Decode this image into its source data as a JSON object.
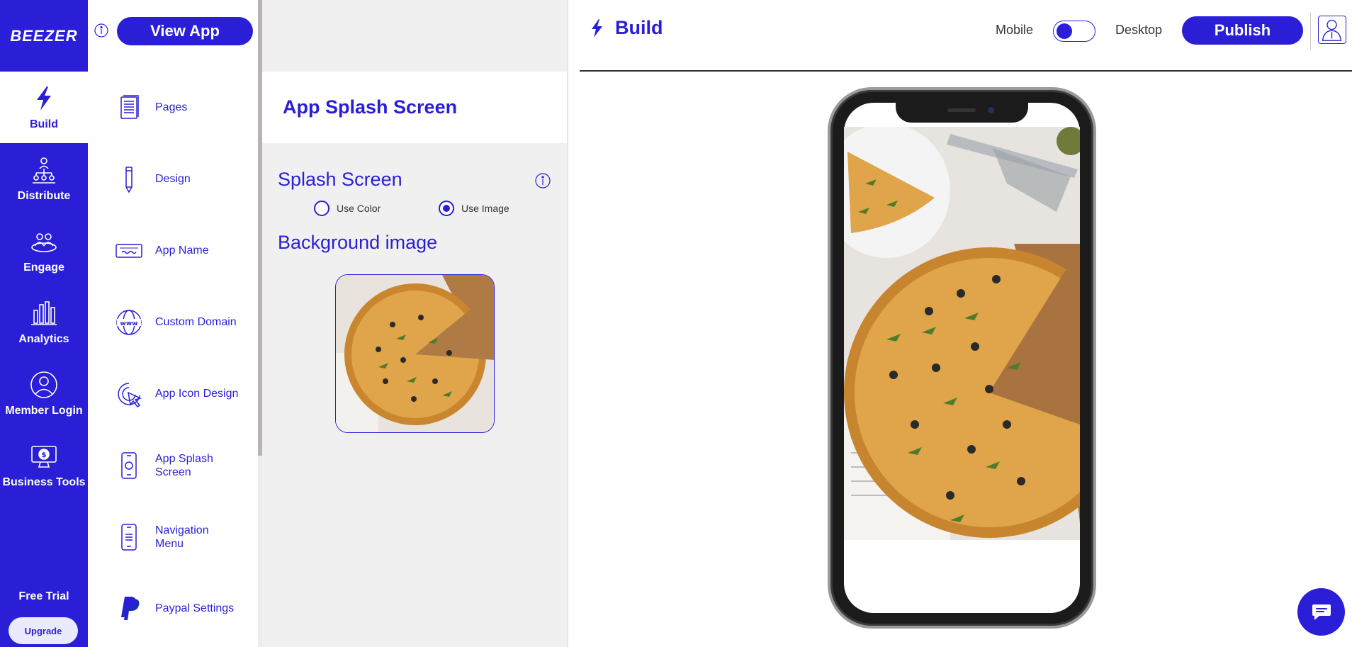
{
  "brand": {
    "logo_text": "BEEZER",
    "accent": "#2a1fd6"
  },
  "rail": {
    "items": [
      {
        "label": "Build",
        "icon": "lightning-icon",
        "active": true
      },
      {
        "label": "Distribute",
        "icon": "distribute-icon"
      },
      {
        "label": "Engage",
        "icon": "engage-icon"
      },
      {
        "label": "Analytics",
        "icon": "analytics-icon"
      },
      {
        "label": "Member Login",
        "icon": "member-icon"
      },
      {
        "label": "Business Tools",
        "icon": "business-tools-icon"
      }
    ],
    "free_trial": "Free Trial",
    "upgrade_label": "Upgrade"
  },
  "menu": {
    "view_app_label": "View App",
    "items": [
      {
        "label": "Pages",
        "icon": "pages-icon"
      },
      {
        "label": "Design",
        "icon": "pencil-icon"
      },
      {
        "label": "App Name",
        "icon": "app-name-icon"
      },
      {
        "label": "Custom Domain",
        "icon": "globe-icon"
      },
      {
        "label": "App Icon Design",
        "icon": "icon-design-icon"
      },
      {
        "label": "App Splash Screen",
        "icon": "splash-screen-icon"
      },
      {
        "label": "Navigation Menu",
        "icon": "navigation-icon"
      },
      {
        "label": "Paypal Settings",
        "icon": "paypal-icon"
      }
    ]
  },
  "settings": {
    "header": "App Splash Screen",
    "splash_title": "Splash Screen",
    "options": [
      {
        "label": "Use Color",
        "checked": false
      },
      {
        "label": "Use Image",
        "checked": true
      }
    ],
    "background_title": "Background image"
  },
  "topbar": {
    "title": "Build",
    "mobile_label": "Mobile",
    "desktop_label": "Desktop",
    "publish_label": "Publish"
  }
}
